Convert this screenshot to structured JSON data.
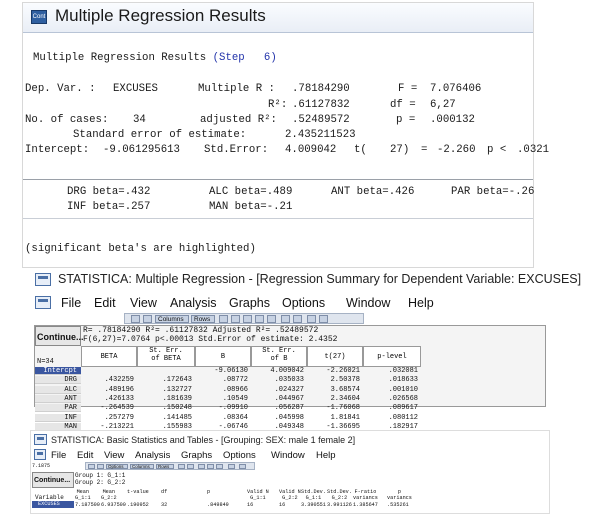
{
  "panel1": {
    "app_icon_text": "Cont",
    "title": "Multiple Regression Results",
    "header_prefix": "Multiple Regression Results",
    "header_step": "(Step",
    "header_step_num": "6)",
    "dep_var_label": "Dep. Var. :",
    "dep_var_value": "EXCUSES",
    "multiple_r_label": "Multiple R :",
    "multiple_r_value": ".78184290",
    "f_label": "F =",
    "f_value": "7.076406",
    "r2_label": "R²:",
    "r2_value": ".61127832",
    "df_label": "df =",
    "df_value": "6,27",
    "n_label": "No. of cases:",
    "n_value": "34",
    "adj_r2_label": "adjusted R²:",
    "adj_r2_value": ".52489572",
    "p_label": "p =",
    "p_value": ".000132",
    "se_label": "Standard error of estimate:",
    "se_value": "2.435211523",
    "intercept_label": "Intercept:",
    "intercept_value": "-9.061295613",
    "std_error_label": "Std.Error:",
    "std_error_value": "4.009042",
    "t_label": "t(",
    "t_df": "27)",
    "t_eq": "=",
    "t_value": "-2.260",
    "p2_label": "p <",
    "p2_value": ".0321",
    "beta": {
      "drg": "DRG beta=.432",
      "alc": "ALC beta=.489",
      "ant": "ANT beta=.426",
      "par": "PAR beta=-.26",
      "inf": "INF beta=.257",
      "man": "MAN beta=-.21"
    },
    "footnote": "(significant beta's are highlighted)"
  },
  "panel2": {
    "title": "STATISTICA: Multiple Regression - [Regression Summary for Dependent Variable: EXCUSES]",
    "menus": [
      "File",
      "Edit",
      "View",
      "Analysis",
      "Graphs",
      "Options",
      "Window",
      "Help"
    ],
    "toolbar": {
      "columns": "Columns",
      "rows": "Rows"
    },
    "continue_label": "Continue...",
    "info_line1": "R= .78184290 R²= .61127832 Adjusted R²= .52489572",
    "info_line2": "F(6,27)=7.0764 p<.00013 Std.Error of estimate: 2.4352",
    "n_label": "N=34",
    "columns": [
      "BETA",
      "St. Err.\nof BETA",
      "B",
      "St. Err.\nof B",
      "t(27)",
      "p-level"
    ],
    "rows": [
      {
        "name": "Intercpt",
        "beta": "",
        "se_beta": "",
        "b": "-9.06130",
        "se_b": "4.009042",
        "t": "-2.26021",
        "p": ".032081"
      },
      {
        "name": "DRG",
        "beta": ".432259",
        "se_beta": ".172643",
        "b": ".08772",
        "se_b": ".035033",
        "t": "2.50378",
        "p": ".018633"
      },
      {
        "name": "ALC",
        "beta": ".489196",
        "se_beta": ".132727",
        "b": ".08966",
        "se_b": ".024327",
        "t": "3.68574",
        "p": ".001010"
      },
      {
        "name": "ANT",
        "beta": ".426133",
        "se_beta": ".181639",
        "b": ".10549",
        "se_b": ".044967",
        "t": "2.34604",
        "p": ".026568"
      },
      {
        "name": "PAR",
        "beta": "-.264539",
        "se_beta": ".150248",
        "b": "-.09910",
        "se_b": ".056287",
        "t": "-1.76068",
        "p": ".089617"
      },
      {
        "name": "INF",
        "beta": ".257279",
        "se_beta": ".141485",
        "b": ".08364",
        "se_b": ".045998",
        "t": "1.81841",
        "p": ".080112"
      },
      {
        "name": "MAN",
        "beta": "-.213221",
        "se_beta": ".155983",
        "b": "-.06746",
        "se_b": ".049348",
        "t": "-1.36695",
        "p": ".182917"
      }
    ]
  },
  "panel3": {
    "title": "STATISTICA: Basic Statistics and Tables - [Grouping: SEX: male 1 female 2]",
    "menus": [
      "File",
      "Edit",
      "View",
      "Analysis",
      "Graphs",
      "Options",
      "Window",
      "Help"
    ],
    "small_label": "7.1875",
    "toolbar": {
      "options": "Options",
      "columns": "Columns",
      "rows": "Rows"
    },
    "continue_label": "Continue...",
    "group1": "Group 1: G_1:1",
    "group2": "Group 2: G_2:2",
    "columns": [
      "Mean\nG_1:1",
      "Mean\nG_2:2",
      "t-value",
      "df",
      "p",
      "Valid N\nG_1:1",
      "Valid N\nG_2:2",
      "Std.Dev.\nG_1:1",
      "Std.Dev.\nG_2:2",
      "F-ratio\nvariancs",
      "p\nvariancs"
    ],
    "row_header": "Variable",
    "row": {
      "name": "EXCUSES",
      "values": [
        "7.187500",
        "6.937500",
        ".190952",
        "32",
        ".849849",
        "16",
        "16",
        "3.390551",
        "3.991126",
        "1.385647",
        ".535261"
      ]
    }
  }
}
